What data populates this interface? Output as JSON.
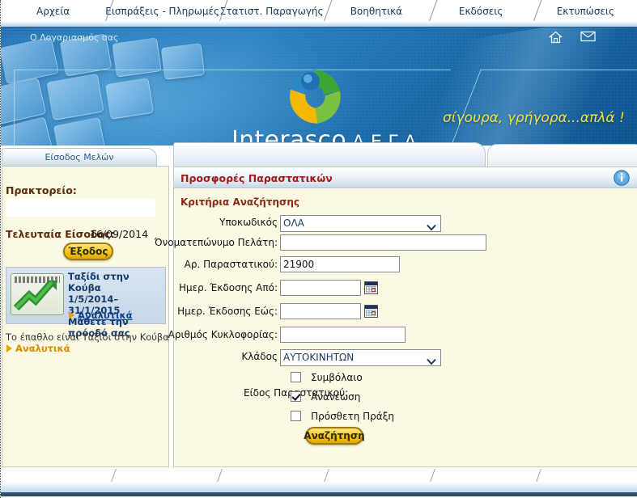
{
  "topnav": {
    "items": [
      {
        "label": "Αρχεία",
        "name": "nav-arxeia"
      },
      {
        "label": "Εισπράξεις - Πληρωμές",
        "name": "nav-eispraxeis-pliromes"
      },
      {
        "label": "Στατιστ. Παραγωγής",
        "name": "nav-statist-paragogis"
      },
      {
        "label": "Βοηθητικά",
        "name": "nav-voithitika"
      },
      {
        "label": "Εκδόσεις",
        "name": "nav-ekdoseis"
      },
      {
        "label": "Εκτυπώσεις",
        "name": "nav-ektyposeis"
      }
    ]
  },
  "banner": {
    "account_text": "Ο Λογαριασμός σας",
    "home_icon": "home-icon",
    "mail_icon": "envelope-icon",
    "brand_name": "Interasco",
    "brand_suffix": " Α.Ε.Γ.Α.",
    "tagline": "σίγουρα, γρήγορα...απλά !",
    "colors": {
      "blue_dark": "#0f5590",
      "blue_mid": "#1f6fb2",
      "tagline_yellow": "#f2e14a"
    }
  },
  "sidebar": {
    "tab_label": "Είσοδος Μελών",
    "agency_label": "Πρακτορείο:",
    "agency_value": "",
    "last_login_label": "Τελευταία Είσοδος:",
    "last_login_date": "16/09/2014",
    "logout_label": "Έξοδος",
    "promo": {
      "image_name": "growth-chart-image",
      "line1": "Ταξίδι στην Κούβα",
      "line2": "1/5/2014–31/1/2015",
      "line3": "Μάθετε την πρόοδό σας",
      "link_label": "Αναλυτικά"
    },
    "award_note": "Το έπαθλο είναι Ταξίδι στην Κούβα",
    "award_link": "Αναλυτικά"
  },
  "main": {
    "panel_title": "Προσφορές Παραστατικών",
    "info_icon": "info-icon",
    "section_title": "Κριτήρια Αναζήτησης",
    "fields": [
      {
        "name": "subcode",
        "label": "Υποκωδικός",
        "type": "select",
        "value": "ΟΛΑ",
        "options": [
          "ΟΛΑ"
        ]
      },
      {
        "name": "customer-name",
        "label": "Όνοματεπώνυμο Πελάτη:",
        "type": "text",
        "value": "",
        "placeholder": ""
      },
      {
        "name": "document-number",
        "label": "Αρ. Παραστατικού:",
        "type": "text",
        "value": "21900",
        "placeholder": ""
      },
      {
        "name": "issue-date-from",
        "label": "Ημερ. Έκδοσης Από:",
        "type": "date",
        "value": "",
        "placeholder": ""
      },
      {
        "name": "issue-date-to",
        "label": "Ημερ. Έκδοσης Εώς:",
        "type": "date",
        "value": "",
        "placeholder": ""
      },
      {
        "name": "plate-number",
        "label": "Αριθμός Κυκλοφορίας:",
        "type": "text",
        "value": "",
        "placeholder": ""
      },
      {
        "name": "branch",
        "label": "Κλάδος",
        "type": "select",
        "value": "ΑΥΤΟΚΙΝΗΤΩΝ",
        "options": [
          "ΑΥΤΟΚΙΝΗΤΩΝ"
        ]
      }
    ],
    "doctype_label": "Είδος Παραστατικού:",
    "doctype_options": [
      {
        "label": "Συμβόλαιο",
        "checked": false,
        "name": "checkbox-symvolaio"
      },
      {
        "label": "Ανανέωση",
        "checked": true,
        "name": "checkbox-ananeosi"
      },
      {
        "label": "Πρόσθετη Πράξη",
        "checked": false,
        "name": "checkbox-prostheti-praxi"
      }
    ],
    "search_button": "Αναζήτηση"
  }
}
